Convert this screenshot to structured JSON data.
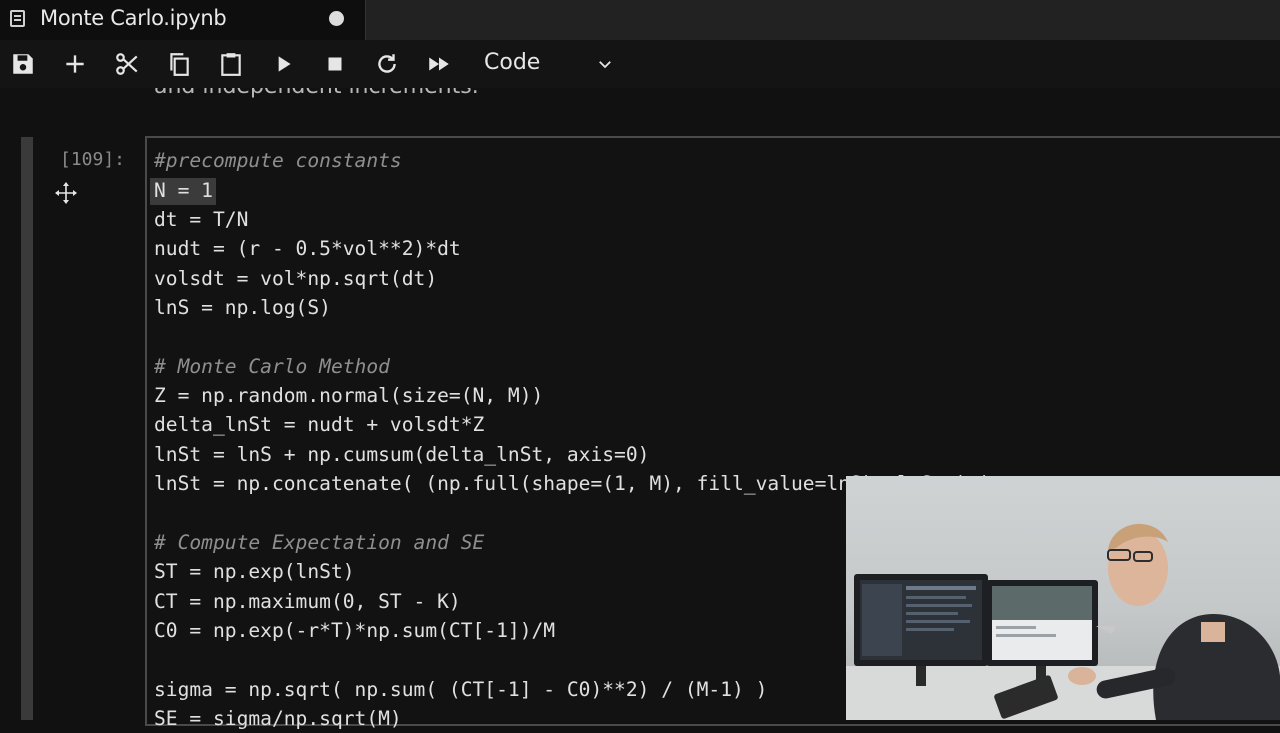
{
  "tab": {
    "title": "Monte Carlo.ipynb",
    "unsaved_dot_icon": "circle-icon"
  },
  "toolbar": {
    "buttons": [
      {
        "name": "save-button",
        "icon": "save-icon"
      },
      {
        "name": "insert-cell-button",
        "icon": "plus-icon"
      },
      {
        "name": "cut-button",
        "icon": "scissors-icon"
      },
      {
        "name": "copy-button",
        "icon": "copy-icon"
      },
      {
        "name": "paste-button",
        "icon": "clipboard-icon"
      },
      {
        "name": "run-button",
        "icon": "play-icon"
      },
      {
        "name": "interrupt-button",
        "icon": "stop-icon"
      },
      {
        "name": "restart-button",
        "icon": "refresh-icon"
      },
      {
        "name": "run-all-button",
        "icon": "fast-forward-icon"
      }
    ],
    "cell_type": "Code"
  },
  "notebook": {
    "previous_cell_text": "and independent increments.",
    "cell": {
      "prompt": "[109]:",
      "lines": [
        "#precompute constants",
        "N = 1",
        "dt = T/N",
        "nudt = (r - 0.5*vol**2)*dt",
        "volsdt = vol*np.sqrt(dt)",
        "lnS = np.log(S)",
        "",
        "# Monte Carlo Method",
        "Z = np.random.normal(size=(N, M))",
        "delta_lnSt = nudt + volsdt*Z",
        "lnSt = lnS + np.cumsum(delta_lnSt, axis=0)",
        "lnSt = np.concatenate( (np.full(shape=(1, M), fill_value=lnS), lnSt ) )",
        "",
        "# Compute Expectation and SE",
        "ST = np.exp(lnSt)",
        "CT = np.maximum(0, ST - K)",
        "C0 = np.exp(-r*T)*np.sum(CT[-1])/M",
        "",
        "sigma = np.sqrt( np.sum( (CT[-1] - C0)**2) / (M-1) )",
        "SE = sigma/np.sqrt(M)"
      ]
    }
  },
  "colors": {
    "background": "#111111",
    "code_text": "#e0e0e0",
    "comment": "#8f8f8f",
    "toolbar": "#141414"
  }
}
